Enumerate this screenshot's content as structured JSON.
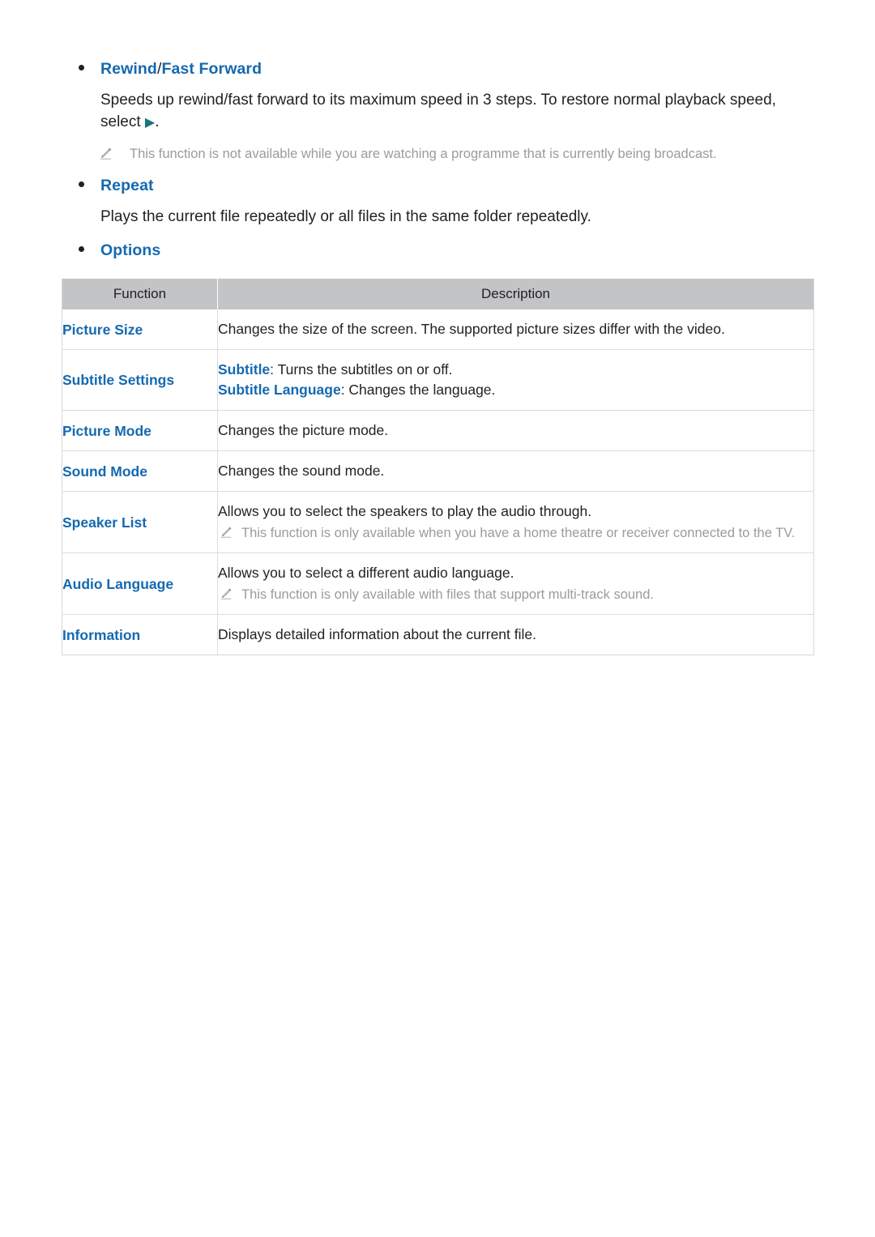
{
  "sections": [
    {
      "heading_parts": [
        "Rewind",
        " / ",
        "Fast Forward"
      ],
      "heading_a": "Rewind",
      "heading_sep": "/",
      "heading_b": "Fast Forward",
      "body_before": "Speeds up rewind/fast forward to its maximum speed in 3 steps. To restore normal playback speed, select ",
      "body_glyph": "▶",
      "body_after": ".",
      "note": "This function is not available while you are watching a programme that is currently being broadcast."
    },
    {
      "heading": "Repeat",
      "body": "Plays the current file repeatedly or all files in the same folder repeatedly."
    },
    {
      "heading": "Options"
    }
  ],
  "table": {
    "headers": {
      "function": "Function",
      "description": "Description"
    },
    "rows": [
      {
        "function": "Picture Size",
        "desc_line1": "Changes the size of the screen. The supported picture sizes differ with the video."
      },
      {
        "function": "Subtitle Settings",
        "label1": "Subtitle",
        "desc_line1": ": Turns the subtitles on or off.",
        "label2": "Subtitle Language",
        "desc_line2": ": Changes the language."
      },
      {
        "function": "Picture Mode",
        "desc_line1": "Changes the picture mode."
      },
      {
        "function": "Sound Mode",
        "desc_line1": "Changes the sound mode."
      },
      {
        "function": "Speaker List",
        "desc_line1": "Allows you to select the speakers to play the audio through.",
        "note": "This function is only available when you have a home theatre or receiver connected to the TV."
      },
      {
        "function": "Audio Language",
        "desc_line1": "Allows you to select a different audio language.",
        "note": "This function is only available with files that support multi-track sound."
      },
      {
        "function": "Information",
        "desc_line1": "Displays detailed information about the current file."
      }
    ]
  },
  "icons": {
    "pencil": "pencil-icon",
    "bullet": "bullet-icon",
    "play": "play-icon"
  },
  "colors": {
    "link_blue": "#1569b0",
    "note_grey": "#9b9b9b",
    "header_grey": "#c3c4c6",
    "play_teal": "#19767d",
    "text": "#231f20"
  }
}
